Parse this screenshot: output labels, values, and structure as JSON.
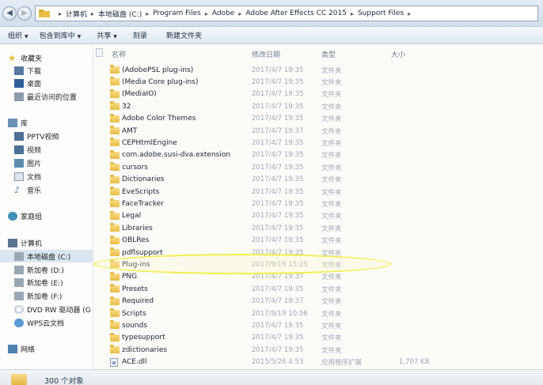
{
  "address_bar": {
    "back_label": "◀",
    "forward_label": "▶",
    "crumbs": [
      "计算机",
      "本地磁盘 (C:)",
      "Program Files",
      "Adobe",
      "Adobe After Effects CC 2015",
      "Support Files"
    ]
  },
  "toolbar": {
    "items": [
      "组织",
      "包含到库中",
      "共享",
      "刻录",
      "新建文件夹"
    ]
  },
  "sidebar": {
    "favorites": {
      "label": "收藏夹",
      "items": [
        "下载",
        "桌面",
        "最近访问的位置"
      ]
    },
    "library": {
      "label": "库",
      "items": [
        "PPTV视频",
        "视频",
        "图片",
        "文档",
        "音乐"
      ]
    },
    "homegroup": "家庭组",
    "computer": {
      "label": "计算机",
      "items": [
        "本地磁盘 (C:)",
        "新加卷 (D:)",
        "新加卷 (E:)",
        "新加卷 (F:)",
        "DVD RW 驱动器 (G",
        "WPS云文档"
      ]
    },
    "network": "网络"
  },
  "columns": {
    "name": "名称",
    "date": "修改日期",
    "type": "类型",
    "size": "大小"
  },
  "files": [
    {
      "name": "(AdobePSL plug-ins)",
      "date": "2017/4/7 19:35",
      "type": "文件夹",
      "size": "",
      "kind": "folder"
    },
    {
      "name": "(Media Core plug-ins)",
      "date": "2017/4/7 19:35",
      "type": "文件夹",
      "size": "",
      "kind": "folder"
    },
    {
      "name": "(MediaIO)",
      "date": "2017/4/7 19:35",
      "type": "文件夹",
      "size": "",
      "kind": "folder"
    },
    {
      "name": "32",
      "date": "2017/4/7 19:35",
      "type": "文件夹",
      "size": "",
      "kind": "folder"
    },
    {
      "name": "Adobe Color Themes",
      "date": "2017/4/7 19:35",
      "type": "文件夹",
      "size": "",
      "kind": "folder"
    },
    {
      "name": "AMT",
      "date": "2017/4/7 19:37",
      "type": "文件夹",
      "size": "",
      "kind": "folder"
    },
    {
      "name": "CEPHtmlEngine",
      "date": "2017/4/7 19:35",
      "type": "文件夹",
      "size": "",
      "kind": "folder"
    },
    {
      "name": "com.adobe.susi-dva.extension",
      "date": "2017/4/7 19:35",
      "type": "文件夹",
      "size": "",
      "kind": "folder"
    },
    {
      "name": "cursors",
      "date": "2017/4/7 19:35",
      "type": "文件夹",
      "size": "",
      "kind": "folder"
    },
    {
      "name": "Dictionaries",
      "date": "2017/4/7 19:35",
      "type": "文件夹",
      "size": "",
      "kind": "folder"
    },
    {
      "name": "EveScripts",
      "date": "2017/4/7 19:35",
      "type": "文件夹",
      "size": "",
      "kind": "folder"
    },
    {
      "name": "FaceTracker",
      "date": "2017/4/7 19:35",
      "type": "文件夹",
      "size": "",
      "kind": "folder"
    },
    {
      "name": "Legal",
      "date": "2017/4/7 19:35",
      "type": "文件夹",
      "size": "",
      "kind": "folder"
    },
    {
      "name": "Libraries",
      "date": "2017/4/7 19:35",
      "type": "文件夹",
      "size": "",
      "kind": "folder"
    },
    {
      "name": "OBLRes",
      "date": "2017/4/7 19:35",
      "type": "文件夹",
      "size": "",
      "kind": "folder"
    },
    {
      "name": "pdflsupport",
      "date": "2017/4/7 19:35",
      "type": "文件夹",
      "size": "",
      "kind": "folder"
    },
    {
      "name": "Plug-ins",
      "date": "2017/9/19 15:25",
      "type": "文件夹",
      "size": "",
      "kind": "folder"
    },
    {
      "name": "PNG",
      "date": "2017/4/7 19:37",
      "type": "文件夹",
      "size": "",
      "kind": "folder"
    },
    {
      "name": "Presets",
      "date": "2017/4/7 19:35",
      "type": "文件夹",
      "size": "",
      "kind": "folder"
    },
    {
      "name": "Required",
      "date": "2017/4/7 19:37",
      "type": "文件夹",
      "size": "",
      "kind": "folder"
    },
    {
      "name": "Scripts",
      "date": "2017/9/19 10:56",
      "type": "文件夹",
      "size": "",
      "kind": "folder"
    },
    {
      "name": "sounds",
      "date": "2017/4/7 19:35",
      "type": "文件夹",
      "size": "",
      "kind": "folder"
    },
    {
      "name": "typesupport",
      "date": "2017/4/7 19:35",
      "type": "文件夹",
      "size": "",
      "kind": "folder"
    },
    {
      "name": "zdictionaries",
      "date": "2017/4/7 19:35",
      "type": "文件夹",
      "size": "",
      "kind": "folder"
    },
    {
      "name": "ACE.dll",
      "date": "2015/5/26 4:53",
      "type": "应用程序扩展",
      "size": "1,707 KB",
      "kind": "dll"
    }
  ],
  "status": {
    "count": "300 个对象"
  },
  "colors": {
    "highlight": "#f2ef4a",
    "selected": "#dbe6f0"
  }
}
